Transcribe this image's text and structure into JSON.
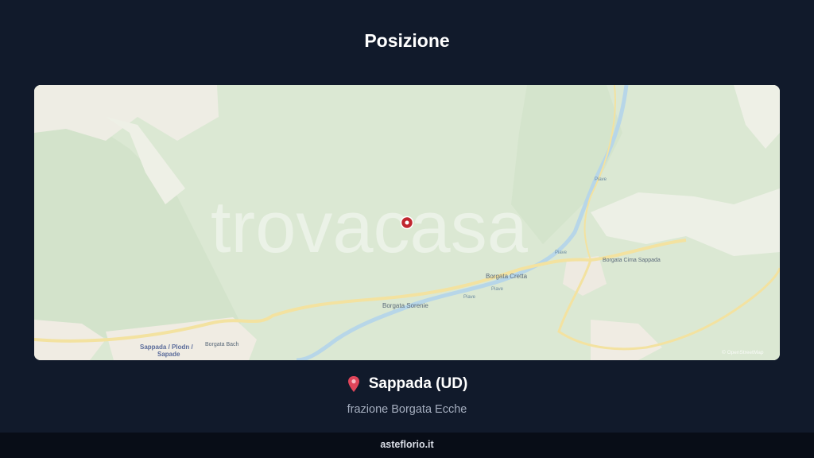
{
  "header": {
    "title": "Posizione"
  },
  "map": {
    "watermark": "trovacasa",
    "attribution": "© OpenStreetMap",
    "labels": {
      "borgata_sorgenti": "Borgata Sorenie",
      "borgata_cretta": "Borgata Cretta",
      "borgata_cima_sappada": "Borgata Cima Sappada",
      "borgata_bach": "Borgata Bach",
      "sappada_line1": "Sappada / Plodn /",
      "sappada_line2": "Sapade",
      "piave_1": "Piave",
      "piave_2": "Piave",
      "piave_3": "Piave",
      "piave_4": "Piave"
    },
    "colors": {
      "land": "#dce9d4",
      "urban": "#f1ece4",
      "road": "#f5e3a2",
      "water": "#b9d7ea",
      "marker": "#c0262f"
    }
  },
  "location": {
    "pin_icon": "map-pin-icon",
    "place": "Sappada (UD)",
    "subtitle": "frazione Borgata Ecche"
  },
  "footer": {
    "site": "asteflorio.it"
  }
}
